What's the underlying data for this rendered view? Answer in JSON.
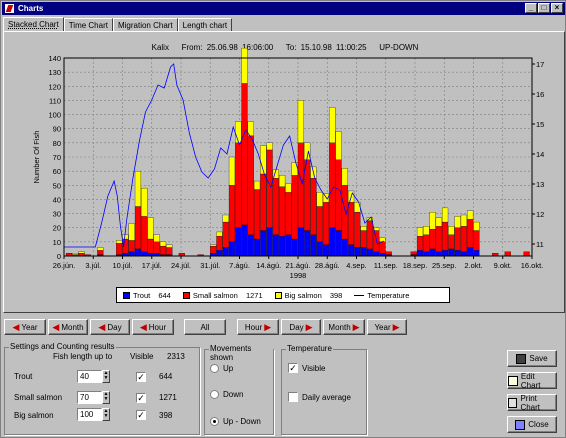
{
  "window": {
    "title": "Charts"
  },
  "tabs": [
    "Stacked Chart",
    "Time Chart",
    "Migration Chart",
    "Length chart"
  ],
  "chart_header": {
    "place": "Kalix",
    "from": "From: 25.06.98 16:06:00",
    "to": "To: 15.10.98 11:00:25",
    "direction": "UP-DOWN"
  },
  "chart_data": {
    "type": "bar",
    "ylabel": "Number Of Fish",
    "ylim": [
      0,
      140
    ],
    "y2lim": [
      10.6,
      17.2
    ],
    "yticks": [
      "0",
      "10",
      "20",
      "30",
      "40",
      "50",
      "60",
      "70",
      "80",
      "90",
      "100",
      "110",
      "120",
      "130",
      "140"
    ],
    "y2ticks": [
      "11",
      "12",
      "13",
      "14",
      "15",
      "16",
      "17"
    ],
    "xticks": [
      "26.jún.",
      "3.júl.",
      "10.júl.",
      "17.júl.",
      "24.júl.",
      "31.júl.",
      "7.ágú.",
      "14.ágú.",
      "21.ágú.",
      "28.ágú.",
      "4.sep.",
      "11.sep.",
      "18.sep.",
      "25.sep.",
      "2.okt.",
      "9.okt.",
      "16.okt."
    ],
    "xsub": "1998",
    "series": [
      {
        "name": "Trout",
        "value": 644,
        "color": "#0000ff"
      },
      {
        "name": "Small salmon",
        "value": 1271,
        "color": "#ff0000"
      },
      {
        "name": "Big salmon",
        "value": 398,
        "color": "#ffff00"
      },
      {
        "name": "Temperature",
        "color": "#0000ff"
      }
    ],
    "bars": [
      [
        0,
        0,
        2,
        0
      ],
      [
        1,
        0,
        1,
        1
      ],
      [
        2,
        0,
        2,
        1
      ],
      [
        3,
        0,
        1,
        0
      ],
      [
        5,
        1,
        3,
        2
      ],
      [
        8,
        1,
        8,
        2
      ],
      [
        9,
        2,
        10,
        3
      ],
      [
        10,
        3,
        8,
        12
      ],
      [
        11,
        5,
        30,
        25
      ],
      [
        12,
        3,
        25,
        20
      ],
      [
        13,
        2,
        10,
        15
      ],
      [
        14,
        2,
        8,
        5
      ],
      [
        15,
        1,
        6,
        3
      ],
      [
        16,
        1,
        5,
        2
      ],
      [
        18,
        0,
        2,
        0
      ],
      [
        21,
        0,
        1,
        0
      ],
      [
        23,
        2,
        5,
        1
      ],
      [
        24,
        4,
        10,
        3
      ],
      [
        25,
        6,
        18,
        5
      ],
      [
        26,
        10,
        40,
        20
      ],
      [
        27,
        20,
        60,
        15
      ],
      [
        28,
        22,
        100,
        25
      ],
      [
        29,
        15,
        70,
        10
      ],
      [
        30,
        12,
        35,
        6
      ],
      [
        31,
        18,
        40,
        20
      ],
      [
        32,
        20,
        55,
        5
      ],
      [
        33,
        15,
        40,
        6
      ],
      [
        34,
        14,
        35,
        8
      ],
      [
        35,
        15,
        30,
        6
      ],
      [
        36,
        12,
        45,
        9
      ],
      [
        37,
        20,
        60,
        30
      ],
      [
        38,
        18,
        50,
        12
      ],
      [
        39,
        15,
        40,
        8
      ],
      [
        40,
        10,
        25,
        10
      ],
      [
        41,
        8,
        30,
        6
      ],
      [
        42,
        20,
        60,
        25
      ],
      [
        43,
        18,
        50,
        20
      ],
      [
        44,
        12,
        38,
        12
      ],
      [
        45,
        8,
        30,
        8
      ],
      [
        46,
        6,
        25,
        7
      ],
      [
        47,
        6,
        12,
        3
      ],
      [
        48,
        5,
        20,
        2
      ],
      [
        49,
        3,
        15,
        2
      ],
      [
        50,
        2,
        8,
        3
      ],
      [
        51,
        1,
        2,
        0
      ],
      [
        55,
        1,
        2,
        0
      ],
      [
        56,
        4,
        10,
        6
      ],
      [
        57,
        3,
        12,
        6
      ],
      [
        58,
        5,
        14,
        12
      ],
      [
        59,
        3,
        18,
        6
      ],
      [
        60,
        4,
        20,
        10
      ],
      [
        61,
        5,
        10,
        6
      ],
      [
        62,
        4,
        16,
        8
      ],
      [
        63,
        3,
        18,
        8
      ],
      [
        64,
        6,
        20,
        6
      ],
      [
        65,
        4,
        14,
        6
      ],
      [
        68,
        0,
        2,
        0
      ],
      [
        70,
        0,
        3,
        0
      ],
      [
        73,
        0,
        3,
        0
      ]
    ],
    "temperature": [
      [
        0,
        10.9
      ],
      [
        3,
        10.9
      ],
      [
        5,
        10.9
      ],
      [
        6,
        11.7
      ],
      [
        7,
        12.6
      ],
      [
        8,
        13.1
      ],
      [
        8.5,
        12.6
      ],
      [
        9,
        11.6
      ],
      [
        9.5,
        10.9
      ],
      [
        10,
        11.8
      ],
      [
        11,
        13.2
      ],
      [
        12,
        14.4
      ],
      [
        13,
        15.4
      ],
      [
        14,
        15.8
      ],
      [
        15,
        16.3
      ],
      [
        16,
        16.2
      ],
      [
        17,
        16.9
      ],
      [
        17.5,
        17.0
      ],
      [
        18,
        16.3
      ],
      [
        19,
        15.8
      ],
      [
        20,
        14.7
      ],
      [
        21,
        13.9
      ],
      [
        22,
        13.4
      ],
      [
        23,
        13.2
      ],
      [
        24,
        13.5
      ],
      [
        25,
        14.2
      ],
      [
        26,
        14.0
      ],
      [
        27,
        14.9
      ],
      [
        28,
        14.3
      ],
      [
        29,
        14.8
      ],
      [
        30,
        14.5
      ],
      [
        31,
        14.0
      ],
      [
        32,
        13.3
      ],
      [
        33,
        12.9
      ],
      [
        34,
        13.6
      ],
      [
        35,
        14.3
      ],
      [
        36,
        14.6
      ],
      [
        37,
        13.7
      ],
      [
        38,
        13.0
      ],
      [
        39,
        14.1
      ],
      [
        40,
        13.2
      ],
      [
        41,
        12.8
      ],
      [
        42,
        12.5
      ],
      [
        43,
        12.9
      ],
      [
        44,
        12.8
      ],
      [
        45,
        12.0
      ],
      [
        46,
        12.7
      ],
      [
        47,
        12.4
      ],
      [
        48,
        11.7
      ],
      [
        49,
        11.9
      ],
      [
        50,
        11.0
      ],
      [
        51,
        11.1
      ]
    ]
  },
  "legend": {
    "trout": "Trout",
    "trout_val": "644",
    "small": "Small salmon",
    "small_val": "1271",
    "big": "Big salmon",
    "big_val": "398",
    "temp": "Temperature"
  },
  "nav": {
    "year_back": "Year",
    "month_back": "Month",
    "day_back": "Day",
    "hour_back": "Hour",
    "all": "All",
    "hour_fwd": "Hour",
    "day_fwd": "Day",
    "month_fwd": "Month",
    "year_fwd": "Year"
  },
  "settings": {
    "title": "Settings and Counting results",
    "col_len": "Fish length up to",
    "col_visible": "Visible",
    "total": "2313",
    "rows": [
      {
        "name": "Trout",
        "length": "40",
        "count": "644"
      },
      {
        "name": "Small salmon",
        "length": "70",
        "count": "1271"
      },
      {
        "name": "Big salmon",
        "length": "100",
        "count": "398"
      }
    ]
  },
  "movements": {
    "title": "Movements shown",
    "up": "Up",
    "down": "Down",
    "updown": "Up - Down",
    "selected": "Up - Down"
  },
  "temperature": {
    "title": "Temperature",
    "visible": "Visible",
    "daily": "Daily average"
  },
  "actions": {
    "save": "Save",
    "edit": "Edit Chart",
    "print": "Print Chart",
    "close": "Close"
  }
}
